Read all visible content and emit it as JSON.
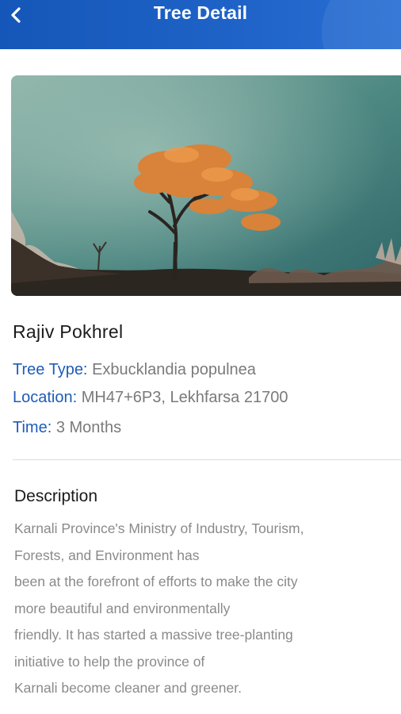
{
  "header": {
    "title": "Tree Detail",
    "back_icon": "chevron-left-icon",
    "background": "#1d5fc4"
  },
  "tree": {
    "owner_name": "Rajiv Pokhrel",
    "tree_type_label": "Tree Type:",
    "tree_type_value": "Exbucklandia populnea",
    "location_label": "Location:",
    "location_value": "MH47+6P3, Lekhfarsa 21700",
    "time_label": "Time:",
    "time_value": "3 Months"
  },
  "description": {
    "title": "Description",
    "lines": [
      "Karnali Province's Ministry of Industry, Tourism,",
      "Forests, and Environment has",
      "been at the forefront of efforts to make the city",
      "more beautiful and environmentally",
      "friendly. It has started a massive tree-planting",
      "initiative to help the province of",
      "Karnali become cleaner and greener."
    ]
  },
  "colors": {
    "accent": "#1f5cb8",
    "value_text": "#7a7a7a",
    "description_text": "#8a8a8a"
  }
}
